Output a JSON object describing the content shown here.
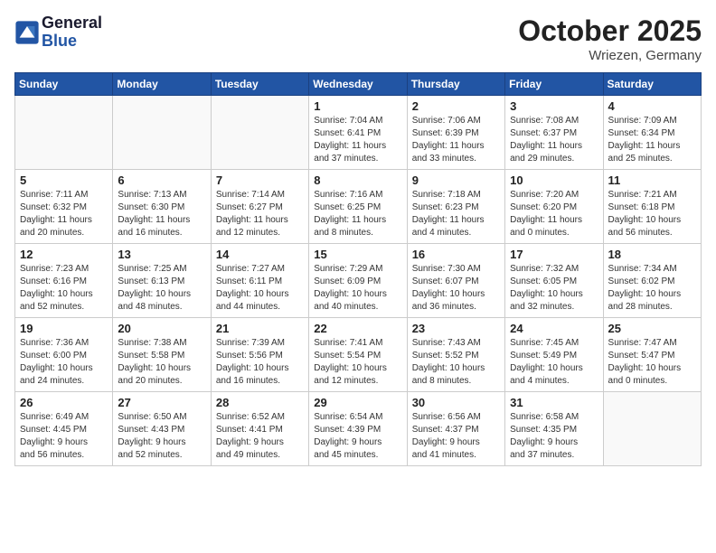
{
  "logo": {
    "line1": "General",
    "line2": "Blue"
  },
  "header": {
    "month": "October 2025",
    "location": "Wriezen, Germany"
  },
  "weekdays": [
    "Sunday",
    "Monday",
    "Tuesday",
    "Wednesday",
    "Thursday",
    "Friday",
    "Saturday"
  ],
  "weeks": [
    [
      {
        "day": "",
        "info": ""
      },
      {
        "day": "",
        "info": ""
      },
      {
        "day": "",
        "info": ""
      },
      {
        "day": "1",
        "info": "Sunrise: 7:04 AM\nSunset: 6:41 PM\nDaylight: 11 hours\nand 37 minutes."
      },
      {
        "day": "2",
        "info": "Sunrise: 7:06 AM\nSunset: 6:39 PM\nDaylight: 11 hours\nand 33 minutes."
      },
      {
        "day": "3",
        "info": "Sunrise: 7:08 AM\nSunset: 6:37 PM\nDaylight: 11 hours\nand 29 minutes."
      },
      {
        "day": "4",
        "info": "Sunrise: 7:09 AM\nSunset: 6:34 PM\nDaylight: 11 hours\nand 25 minutes."
      }
    ],
    [
      {
        "day": "5",
        "info": "Sunrise: 7:11 AM\nSunset: 6:32 PM\nDaylight: 11 hours\nand 20 minutes."
      },
      {
        "day": "6",
        "info": "Sunrise: 7:13 AM\nSunset: 6:30 PM\nDaylight: 11 hours\nand 16 minutes."
      },
      {
        "day": "7",
        "info": "Sunrise: 7:14 AM\nSunset: 6:27 PM\nDaylight: 11 hours\nand 12 minutes."
      },
      {
        "day": "8",
        "info": "Sunrise: 7:16 AM\nSunset: 6:25 PM\nDaylight: 11 hours\nand 8 minutes."
      },
      {
        "day": "9",
        "info": "Sunrise: 7:18 AM\nSunset: 6:23 PM\nDaylight: 11 hours\nand 4 minutes."
      },
      {
        "day": "10",
        "info": "Sunrise: 7:20 AM\nSunset: 6:20 PM\nDaylight: 11 hours\nand 0 minutes."
      },
      {
        "day": "11",
        "info": "Sunrise: 7:21 AM\nSunset: 6:18 PM\nDaylight: 10 hours\nand 56 minutes."
      }
    ],
    [
      {
        "day": "12",
        "info": "Sunrise: 7:23 AM\nSunset: 6:16 PM\nDaylight: 10 hours\nand 52 minutes."
      },
      {
        "day": "13",
        "info": "Sunrise: 7:25 AM\nSunset: 6:13 PM\nDaylight: 10 hours\nand 48 minutes."
      },
      {
        "day": "14",
        "info": "Sunrise: 7:27 AM\nSunset: 6:11 PM\nDaylight: 10 hours\nand 44 minutes."
      },
      {
        "day": "15",
        "info": "Sunrise: 7:29 AM\nSunset: 6:09 PM\nDaylight: 10 hours\nand 40 minutes."
      },
      {
        "day": "16",
        "info": "Sunrise: 7:30 AM\nSunset: 6:07 PM\nDaylight: 10 hours\nand 36 minutes."
      },
      {
        "day": "17",
        "info": "Sunrise: 7:32 AM\nSunset: 6:05 PM\nDaylight: 10 hours\nand 32 minutes."
      },
      {
        "day": "18",
        "info": "Sunrise: 7:34 AM\nSunset: 6:02 PM\nDaylight: 10 hours\nand 28 minutes."
      }
    ],
    [
      {
        "day": "19",
        "info": "Sunrise: 7:36 AM\nSunset: 6:00 PM\nDaylight: 10 hours\nand 24 minutes."
      },
      {
        "day": "20",
        "info": "Sunrise: 7:38 AM\nSunset: 5:58 PM\nDaylight: 10 hours\nand 20 minutes."
      },
      {
        "day": "21",
        "info": "Sunrise: 7:39 AM\nSunset: 5:56 PM\nDaylight: 10 hours\nand 16 minutes."
      },
      {
        "day": "22",
        "info": "Sunrise: 7:41 AM\nSunset: 5:54 PM\nDaylight: 10 hours\nand 12 minutes."
      },
      {
        "day": "23",
        "info": "Sunrise: 7:43 AM\nSunset: 5:52 PM\nDaylight: 10 hours\nand 8 minutes."
      },
      {
        "day": "24",
        "info": "Sunrise: 7:45 AM\nSunset: 5:49 PM\nDaylight: 10 hours\nand 4 minutes."
      },
      {
        "day": "25",
        "info": "Sunrise: 7:47 AM\nSunset: 5:47 PM\nDaylight: 10 hours\nand 0 minutes."
      }
    ],
    [
      {
        "day": "26",
        "info": "Sunrise: 6:49 AM\nSunset: 4:45 PM\nDaylight: 9 hours\nand 56 minutes."
      },
      {
        "day": "27",
        "info": "Sunrise: 6:50 AM\nSunset: 4:43 PM\nDaylight: 9 hours\nand 52 minutes."
      },
      {
        "day": "28",
        "info": "Sunrise: 6:52 AM\nSunset: 4:41 PM\nDaylight: 9 hours\nand 49 minutes."
      },
      {
        "day": "29",
        "info": "Sunrise: 6:54 AM\nSunset: 4:39 PM\nDaylight: 9 hours\nand 45 minutes."
      },
      {
        "day": "30",
        "info": "Sunrise: 6:56 AM\nSunset: 4:37 PM\nDaylight: 9 hours\nand 41 minutes."
      },
      {
        "day": "31",
        "info": "Sunrise: 6:58 AM\nSunset: 4:35 PM\nDaylight: 9 hours\nand 37 minutes."
      },
      {
        "day": "",
        "info": ""
      }
    ]
  ]
}
